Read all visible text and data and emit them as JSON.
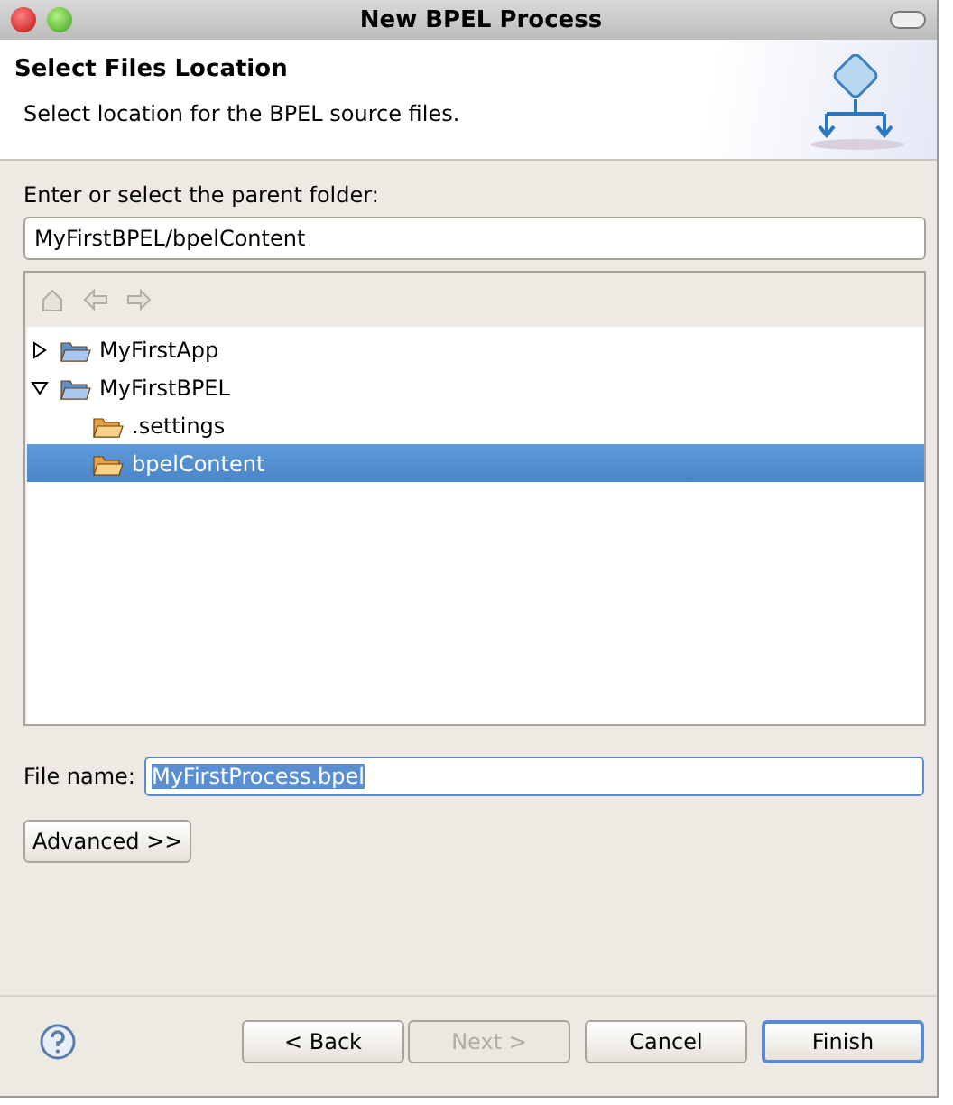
{
  "window": {
    "title": "New BPEL Process"
  },
  "header": {
    "title": "Select Files Location",
    "description": "Select location for the BPEL source files."
  },
  "folder": {
    "label": "Enter or select the parent folder:",
    "value": "MyFirstBPEL/bpelContent"
  },
  "tree": {
    "items": [
      {
        "label": "MyFirstApp",
        "kind": "project",
        "expanded": false,
        "selected": false
      },
      {
        "label": "MyFirstBPEL",
        "kind": "project",
        "expanded": true,
        "selected": false,
        "children": [
          {
            "label": ".settings",
            "selected": false
          },
          {
            "label": "bpelContent",
            "selected": true
          }
        ]
      }
    ]
  },
  "file_name": {
    "label": "File name:",
    "value": "MyFirstProcess.bpel"
  },
  "advanced_button": "Advanced >>",
  "buttons": [
    {
      "label": "< Back",
      "disabled": false,
      "default": false
    },
    {
      "label": "Next >",
      "disabled": true,
      "default": false
    },
    {
      "label": "Cancel",
      "disabled": false,
      "default": false
    },
    {
      "label": "Finish",
      "disabled": false,
      "default": true
    }
  ]
}
